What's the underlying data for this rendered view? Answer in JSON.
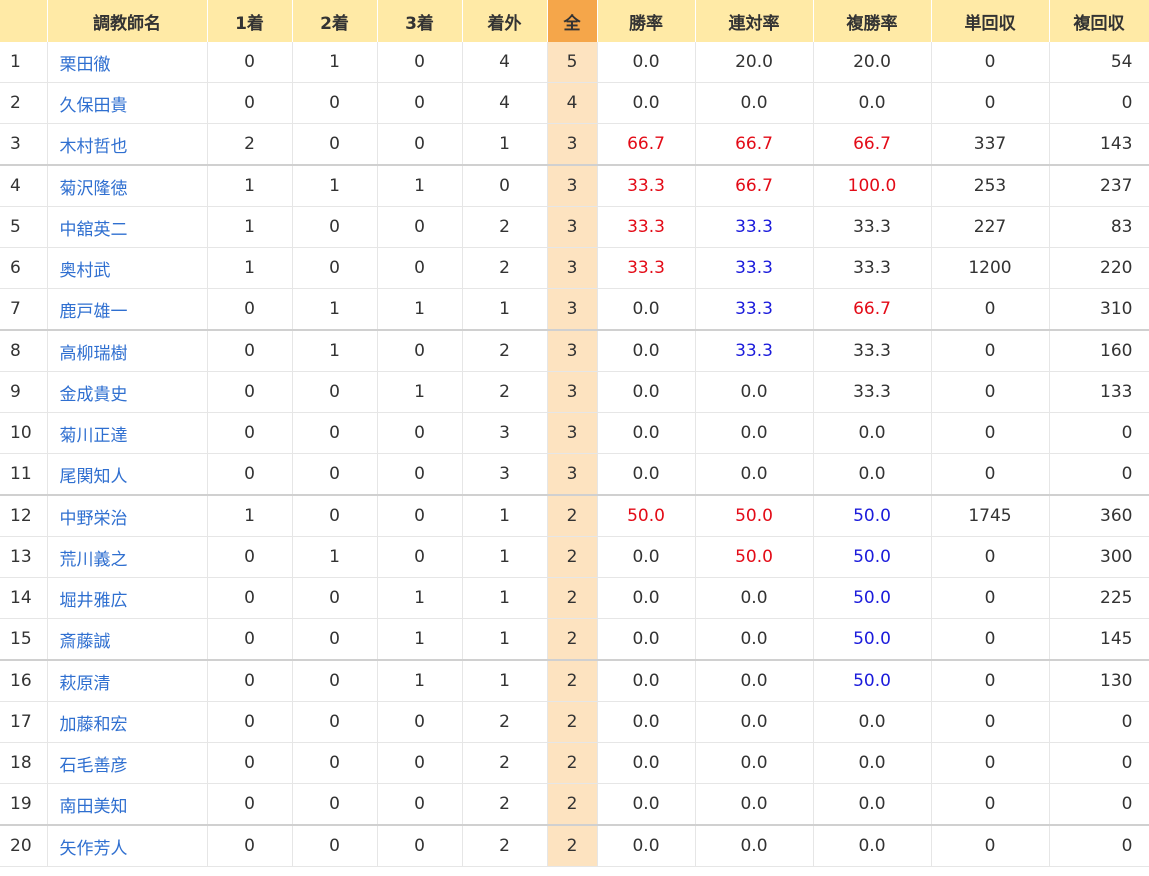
{
  "colors": {
    "header_bg": "#ffeaa6",
    "header_all_bg": "#f5a64a",
    "all_col_bg": "#fde3c0",
    "red": "#e30b17",
    "blue": "#1b1bdb",
    "link": "#2f6fd0"
  },
  "table": {
    "headers": [
      "",
      "調教師名",
      "1着",
      "2着",
      "3着",
      "着外",
      "全",
      "勝率",
      "連対率",
      "複勝率",
      "単回収",
      "複回収"
    ],
    "rows": [
      {
        "no": "1",
        "name": "栗田徹",
        "w1": "0",
        "w2": "1",
        "w3": "0",
        "out": "4",
        "all": "5",
        "win": "0.0",
        "ren": "20.0",
        "fuku": "20.0",
        "tan": "0",
        "fk": "54",
        "wc": "",
        "rc": "",
        "fc": ""
      },
      {
        "no": "2",
        "name": "久保田貴",
        "w1": "0",
        "w2": "0",
        "w3": "0",
        "out": "4",
        "all": "4",
        "win": "0.0",
        "ren": "0.0",
        "fuku": "0.0",
        "tan": "0",
        "fk": "0",
        "wc": "",
        "rc": "",
        "fc": ""
      },
      {
        "no": "3",
        "name": "木村哲也",
        "w1": "2",
        "w2": "0",
        "w3": "0",
        "out": "1",
        "all": "3",
        "win": "66.7",
        "ren": "66.7",
        "fuku": "66.7",
        "tan": "337",
        "fk": "143",
        "wc": "red",
        "rc": "red",
        "fc": "red"
      },
      {
        "no": "4",
        "name": "菊沢隆徳",
        "w1": "1",
        "w2": "1",
        "w3": "1",
        "out": "0",
        "all": "3",
        "win": "33.3",
        "ren": "66.7",
        "fuku": "100.0",
        "tan": "253",
        "fk": "237",
        "wc": "red",
        "rc": "red",
        "fc": "red"
      },
      {
        "no": "5",
        "name": "中舘英二",
        "w1": "1",
        "w2": "0",
        "w3": "0",
        "out": "2",
        "all": "3",
        "win": "33.3",
        "ren": "33.3",
        "fuku": "33.3",
        "tan": "227",
        "fk": "83",
        "wc": "red",
        "rc": "blue",
        "fc": ""
      },
      {
        "no": "6",
        "name": "奥村武",
        "w1": "1",
        "w2": "0",
        "w3": "0",
        "out": "2",
        "all": "3",
        "win": "33.3",
        "ren": "33.3",
        "fuku": "33.3",
        "tan": "1200",
        "fk": "220",
        "wc": "red",
        "rc": "blue",
        "fc": ""
      },
      {
        "no": "7",
        "name": "鹿戸雄一",
        "w1": "0",
        "w2": "1",
        "w3": "1",
        "out": "1",
        "all": "3",
        "win": "0.0",
        "ren": "33.3",
        "fuku": "66.7",
        "tan": "0",
        "fk": "310",
        "wc": "",
        "rc": "blue",
        "fc": "red"
      },
      {
        "no": "8",
        "name": "高柳瑞樹",
        "w1": "0",
        "w2": "1",
        "w3": "0",
        "out": "2",
        "all": "3",
        "win": "0.0",
        "ren": "33.3",
        "fuku": "33.3",
        "tan": "0",
        "fk": "160",
        "wc": "",
        "rc": "blue",
        "fc": ""
      },
      {
        "no": "9",
        "name": "金成貴史",
        "w1": "0",
        "w2": "0",
        "w3": "1",
        "out": "2",
        "all": "3",
        "win": "0.0",
        "ren": "0.0",
        "fuku": "33.3",
        "tan": "0",
        "fk": "133",
        "wc": "",
        "rc": "",
        "fc": ""
      },
      {
        "no": "10",
        "name": "菊川正達",
        "w1": "0",
        "w2": "0",
        "w3": "0",
        "out": "3",
        "all": "3",
        "win": "0.0",
        "ren": "0.0",
        "fuku": "0.0",
        "tan": "0",
        "fk": "0",
        "wc": "",
        "rc": "",
        "fc": ""
      },
      {
        "no": "11",
        "name": "尾関知人",
        "w1": "0",
        "w2": "0",
        "w3": "0",
        "out": "3",
        "all": "3",
        "win": "0.0",
        "ren": "0.0",
        "fuku": "0.0",
        "tan": "0",
        "fk": "0",
        "wc": "",
        "rc": "",
        "fc": ""
      },
      {
        "no": "12",
        "name": "中野栄治",
        "w1": "1",
        "w2": "0",
        "w3": "0",
        "out": "1",
        "all": "2",
        "win": "50.0",
        "ren": "50.0",
        "fuku": "50.0",
        "tan": "1745",
        "fk": "360",
        "wc": "red",
        "rc": "red",
        "fc": "blue"
      },
      {
        "no": "13",
        "name": "荒川義之",
        "w1": "0",
        "w2": "1",
        "w3": "0",
        "out": "1",
        "all": "2",
        "win": "0.0",
        "ren": "50.0",
        "fuku": "50.0",
        "tan": "0",
        "fk": "300",
        "wc": "",
        "rc": "red",
        "fc": "blue"
      },
      {
        "no": "14",
        "name": "堀井雅広",
        "w1": "0",
        "w2": "0",
        "w3": "1",
        "out": "1",
        "all": "2",
        "win": "0.0",
        "ren": "0.0",
        "fuku": "50.0",
        "tan": "0",
        "fk": "225",
        "wc": "",
        "rc": "",
        "fc": "blue"
      },
      {
        "no": "15",
        "name": "斎藤誠",
        "w1": "0",
        "w2": "0",
        "w3": "1",
        "out": "1",
        "all": "2",
        "win": "0.0",
        "ren": "0.0",
        "fuku": "50.0",
        "tan": "0",
        "fk": "145",
        "wc": "",
        "rc": "",
        "fc": "blue"
      },
      {
        "no": "16",
        "name": "萩原清",
        "w1": "0",
        "w2": "0",
        "w3": "1",
        "out": "1",
        "all": "2",
        "win": "0.0",
        "ren": "0.0",
        "fuku": "50.0",
        "tan": "0",
        "fk": "130",
        "wc": "",
        "rc": "",
        "fc": "blue"
      },
      {
        "no": "17",
        "name": "加藤和宏",
        "w1": "0",
        "w2": "0",
        "w3": "0",
        "out": "2",
        "all": "2",
        "win": "0.0",
        "ren": "0.0",
        "fuku": "0.0",
        "tan": "0",
        "fk": "0",
        "wc": "",
        "rc": "",
        "fc": ""
      },
      {
        "no": "18",
        "name": "石毛善彦",
        "w1": "0",
        "w2": "0",
        "w3": "0",
        "out": "2",
        "all": "2",
        "win": "0.0",
        "ren": "0.0",
        "fuku": "0.0",
        "tan": "0",
        "fk": "0",
        "wc": "",
        "rc": "",
        "fc": ""
      },
      {
        "no": "19",
        "name": "南田美知",
        "w1": "0",
        "w2": "0",
        "w3": "0",
        "out": "2",
        "all": "2",
        "win": "0.0",
        "ren": "0.0",
        "fuku": "0.0",
        "tan": "0",
        "fk": "0",
        "wc": "",
        "rc": "",
        "fc": ""
      },
      {
        "no": "20",
        "name": "矢作芳人",
        "w1": "0",
        "w2": "0",
        "w3": "0",
        "out": "2",
        "all": "2",
        "win": "0.0",
        "ren": "0.0",
        "fuku": "0.0",
        "tan": "0",
        "fk": "0",
        "wc": "",
        "rc": "",
        "fc": ""
      }
    ]
  }
}
